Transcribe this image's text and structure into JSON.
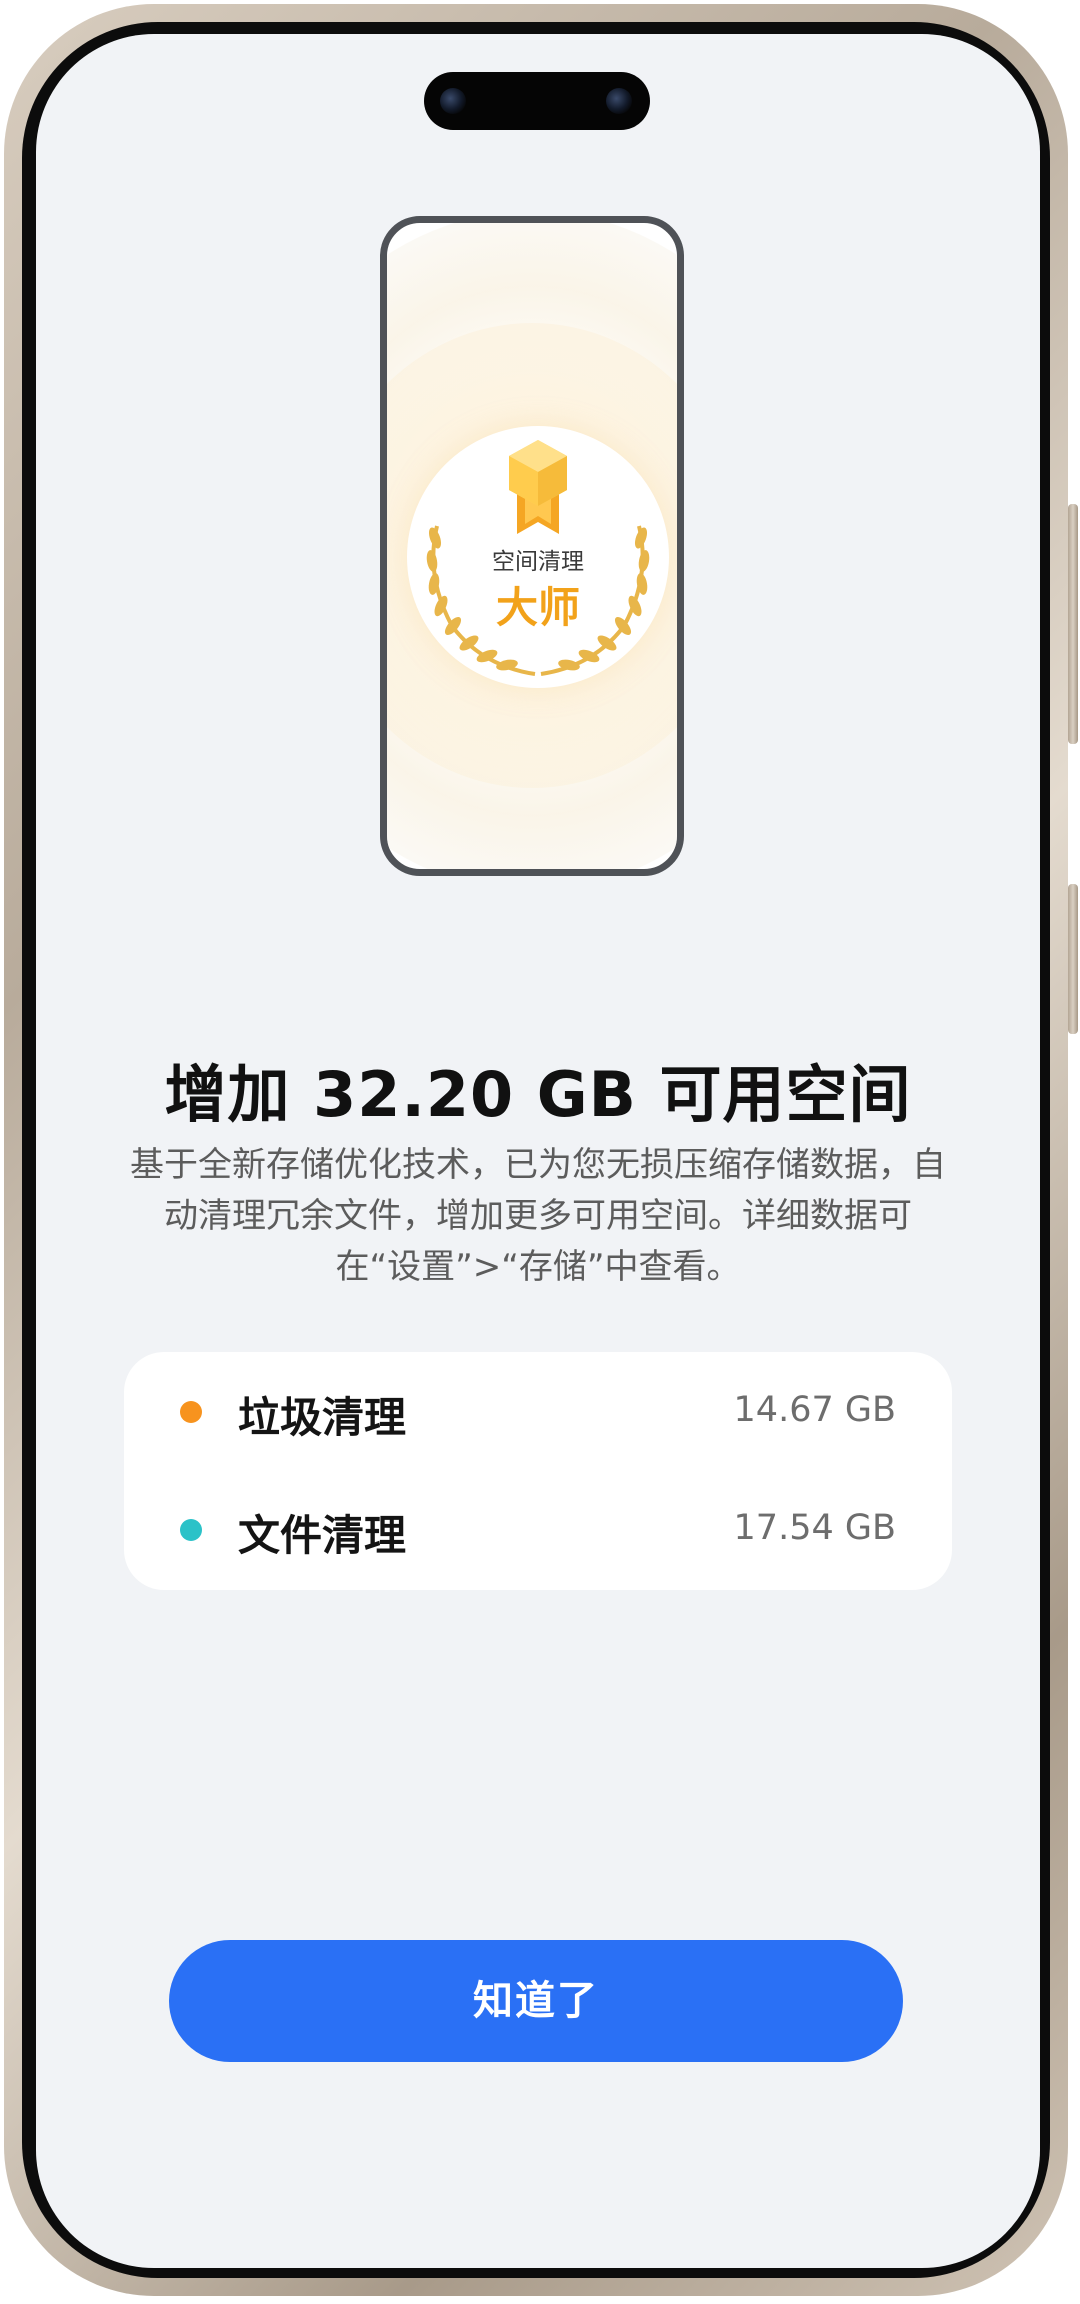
{
  "illustration": {
    "badge_small": "空间清理",
    "badge_big": "大师"
  },
  "headline": "增加 32.20 GB 可用空间",
  "description": "基于全新存储优化技术，已为您无损压缩存储数据，自动清理冗余文件，增加更多可用空间。详细数据可在“设置”>“存储”中查看。",
  "details": [
    {
      "label": "垃圾清理",
      "value": "14.67 GB",
      "dot_color": "#f7931e"
    },
    {
      "label": "文件清理",
      "value": "17.54 GB",
      "dot_color": "#2bc2c8"
    }
  ],
  "button": {
    "label": "知道了"
  },
  "colors": {
    "accent": "#2a70f5",
    "badge_gold": "#f2a21a",
    "screen_background": "#f1f3f6"
  },
  "icons": [
    "medal-icon",
    "laurel-icon"
  ]
}
